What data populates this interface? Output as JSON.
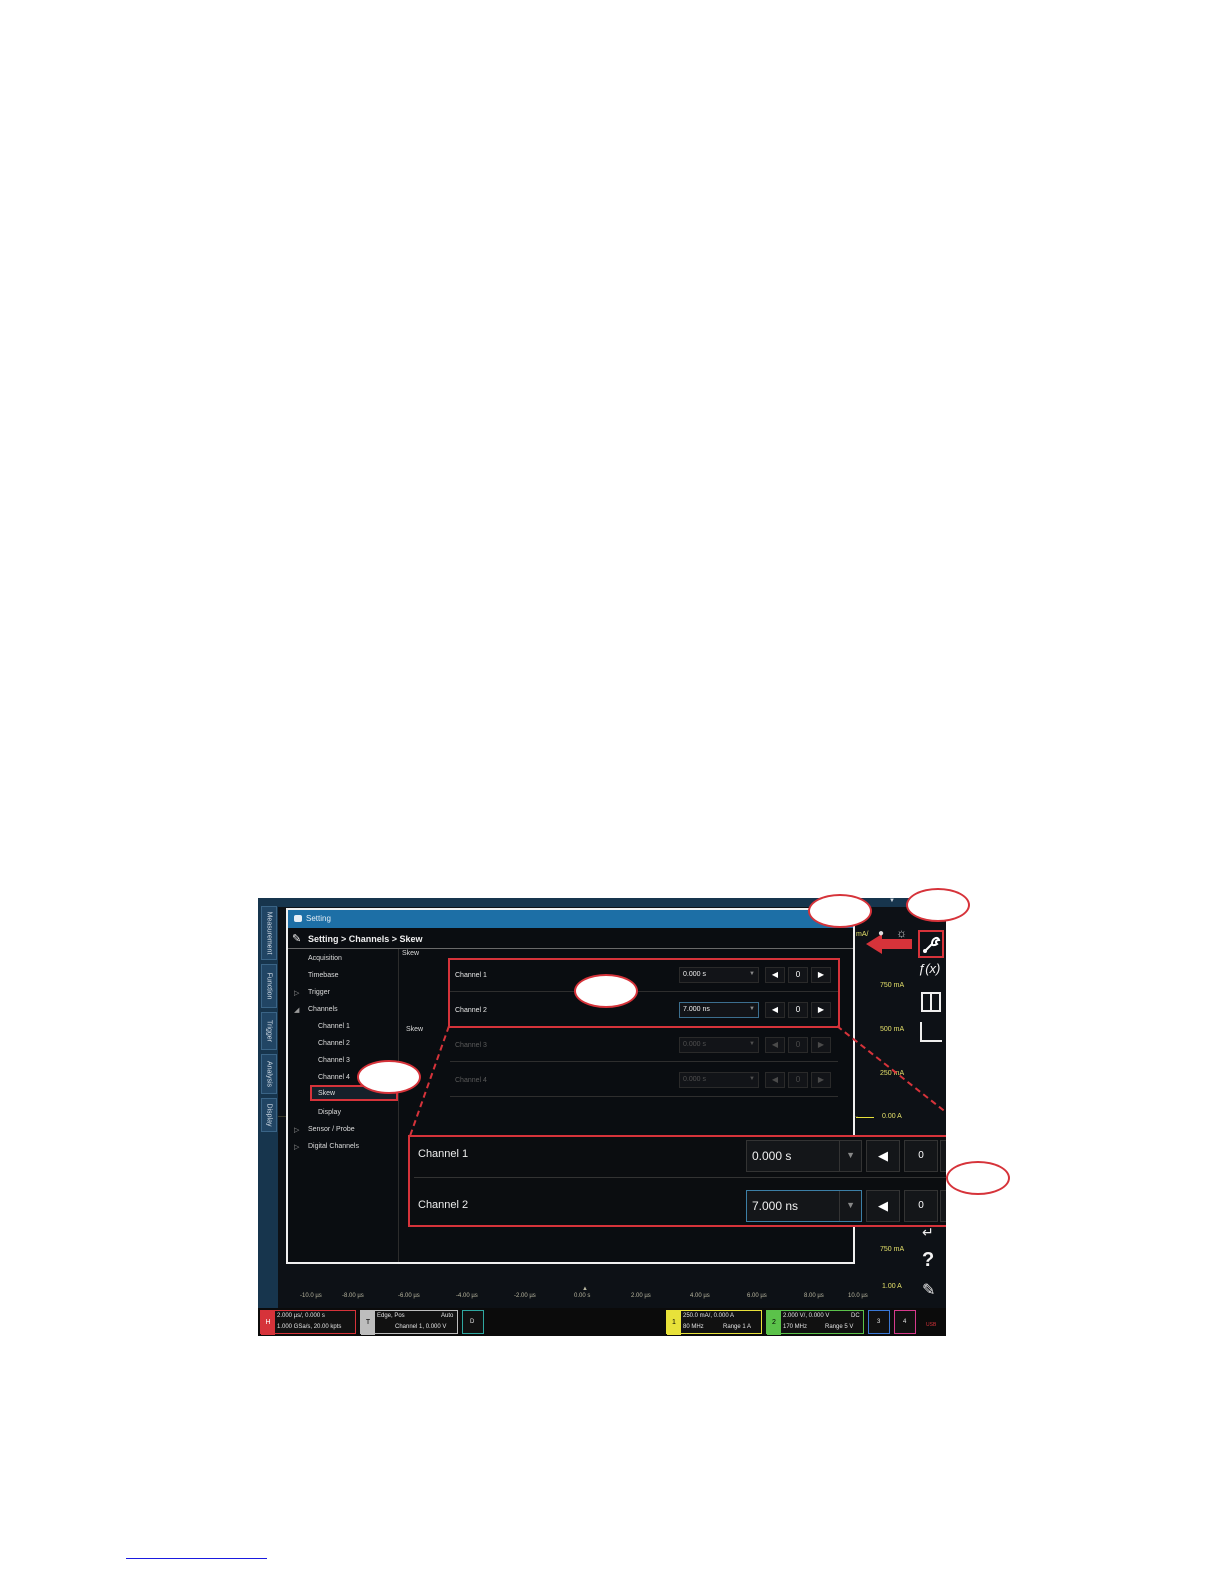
{
  "left_tabs": [
    "Measurement",
    "Function",
    "Trigger",
    "Analysis",
    "Display"
  ],
  "dialog": {
    "title": "Setting",
    "breadcrumb": "Setting > Channels > Skew",
    "nav": {
      "acquisition": "Acquisition",
      "timebase": "Timebase",
      "trigger": "Trigger",
      "channels": "Channels",
      "channel1": "Channel 1",
      "channel2": "Channel 2",
      "channel3": "Channel 3",
      "channel4": "Channel 4",
      "skew": "Skew",
      "display": "Display",
      "sensor_probe": "Sensor / Probe",
      "digital_channels": "Digital Channels"
    },
    "panel_header": "Skew",
    "panel_side_label": "Skew",
    "rows": [
      {
        "label": "Channel 1",
        "value": "0.000 s",
        "step": "0"
      },
      {
        "label": "Channel 2",
        "value": "7.000 ns",
        "step": "0"
      },
      {
        "label": "Channel 3",
        "value": "0.000 s",
        "step": "0"
      },
      {
        "label": "Channel 4",
        "value": "0.000 s",
        "step": "0"
      }
    ]
  },
  "zoom": {
    "rows": [
      {
        "label": "Channel 1",
        "value": "0.000 s",
        "step": "0"
      },
      {
        "label": "Channel 2",
        "value": "7.000 ns",
        "step": "0"
      }
    ]
  },
  "glyphs": {
    "left_arrow": "◀",
    "right_arrow": "▶",
    "caret": "▼",
    "question": "?",
    "fx": "ƒ(x)"
  },
  "right_scale": {
    "top_unit": "mA/",
    "v750_top": "750 mA",
    "v500": "500 mA",
    "v250": "250 mA",
    "zero": "0.00 A",
    "v750_bottom": "750 mA",
    "v1": "1.00 A"
  },
  "time_ticks": [
    "-10.0 µs",
    "-8.00 µs",
    "-6.00 µs",
    "-4.00 µs",
    "-2.00 µs",
    "0.00 s",
    "2.00 µs",
    "4.00 µs",
    "6.00 µs",
    "8.00 µs",
    "10.0 µs"
  ],
  "bottom": {
    "h_box": {
      "num": "H",
      "line1": "2.000 µs/, 0.000 s",
      "line2": "1.000 GSa/s, 20.00 kpts"
    },
    "t_box": {
      "num": "T",
      "line1a": "Edge, Pos",
      "line1b": "Auto",
      "line2": "Channel 1, 0.000 V"
    },
    "d_box": "D",
    "ch1": {
      "num": "1",
      "line1": "250.0 mA/, 0.000 A",
      "line2a": "80 MHz",
      "line2b": "Range  1 A"
    },
    "ch2": {
      "num": "2",
      "line1a": "2.000 V/, 0.000 V",
      "line1b": "DC",
      "line2a": "170 MHz",
      "line2b": "Range  5 V"
    },
    "ch3": "3",
    "ch4": "4",
    "usb": "USB"
  },
  "colors": {
    "accent_red": "#d6333a",
    "title_blue": "#1d6fa6",
    "ch1_yellow": "#e8e23a",
    "ch2_green": "#5bc24a"
  }
}
